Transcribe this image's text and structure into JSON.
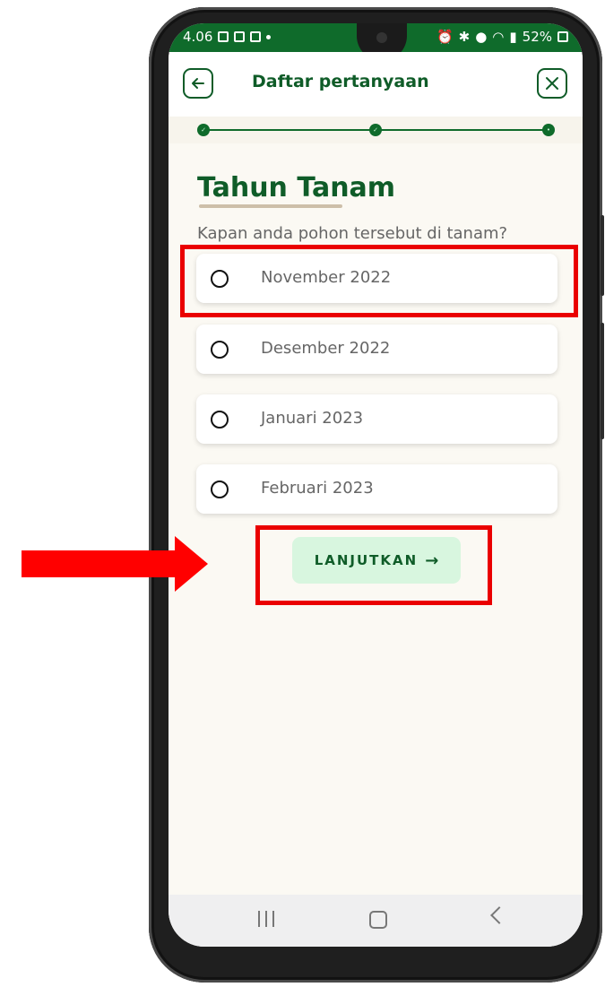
{
  "status_bar": {
    "time": "4.06",
    "battery": "52%"
  },
  "app_bar": {
    "title": "Daftar pertanyaan",
    "back_icon": "back-arrow-icon",
    "close_icon": "close-icon"
  },
  "stepper": {
    "steps": [
      "done",
      "done",
      "current"
    ]
  },
  "question_page": {
    "heading": "Tahun Tanam",
    "question": "Kapan anda pohon tersebut di tanam?",
    "options": [
      {
        "label": "November 2022",
        "selected": false
      },
      {
        "label": "Desember 2022",
        "selected": false
      },
      {
        "label": "Januari 2023",
        "selected": false
      },
      {
        "label": "Februari 2023",
        "selected": false
      }
    ],
    "continue_label": "LANJUTKAN",
    "continue_icon": "arrow-right-icon"
  },
  "nav_bar": {
    "recents_icon": "recents-icon",
    "home_icon": "home-icon",
    "back_icon": "nav-back-icon"
  },
  "annotations": {
    "highlight_color": "#ea0000",
    "arrow_color": "#ff0000"
  }
}
